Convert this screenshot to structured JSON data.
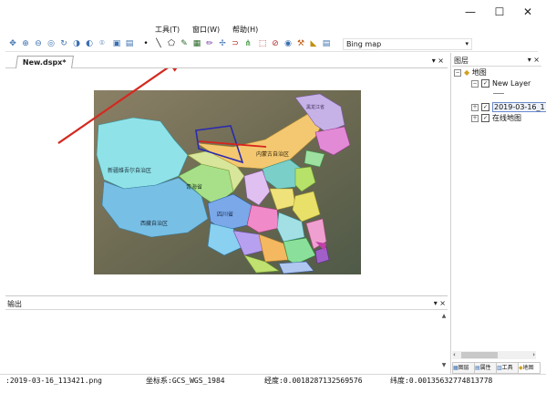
{
  "window_controls": {
    "minimize": "—",
    "maximize": "☐",
    "close": "✕"
  },
  "menu": [
    {
      "label": "工具(T)"
    },
    {
      "label": "窗口(W)"
    },
    {
      "label": "帮助(H)"
    }
  ],
  "toolbar": {
    "basemap_value": "Bing map",
    "basemap_arrow": "▾"
  },
  "document": {
    "tab_label": "New.dspx*",
    "tab_controls": "▾ ×"
  },
  "map": {
    "labels": [
      {
        "text": "新疆维吾尔自治区"
      },
      {
        "text": "西藏自治区"
      },
      {
        "text": "内蒙古自治区"
      },
      {
        "text": "黑龙江省"
      },
      {
        "text": "青海省"
      },
      {
        "text": "四川省"
      }
    ]
  },
  "output_panel": {
    "title": "输出",
    "controls": "▾ ×"
  },
  "layers_panel": {
    "title": "图层",
    "controls": "▾ ×",
    "root": "地图",
    "items": [
      {
        "label": "New Layer"
      },
      {
        "label": "2019-03-16_1"
      },
      {
        "label": "在线地图"
      }
    ],
    "bottom_tabs": [
      "图层",
      "属性",
      "工具",
      "地图"
    ]
  },
  "status": {
    "file": ":2019-03-16_113421.png",
    "crs": "坐标系:GCS_WGS_1984",
    "lon": "经度:0.0018287132569576",
    "lat": "纬度:0.00135632774813778"
  },
  "colors": {
    "annotation_arrow": "#d42a20",
    "drawn_polygon": "#2a2ab0",
    "drawn_line": "#d8231e"
  }
}
